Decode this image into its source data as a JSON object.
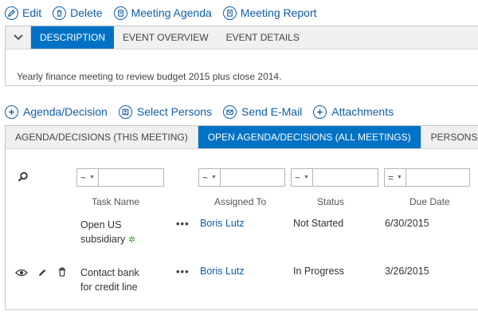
{
  "toolbar": {
    "edit": "Edit",
    "delete": "Delete",
    "meeting_agenda": "Meeting Agenda",
    "meeting_report": "Meeting Report"
  },
  "desc_tabs": [
    "DESCRIPTION",
    "EVENT OVERVIEW",
    "EVENT DETAILS"
  ],
  "description": "Yearly finance meeting to review budget 2015 plus close 2014.",
  "actions": {
    "agenda": "Agenda/Decision",
    "persons": "Select Persons",
    "email": "Send E-Mail",
    "attachments": "Attachments"
  },
  "grid_tabs": [
    "AGENDA/DECISIONS (THIS MEETING)",
    "OPEN AGENDA/DECISIONS (ALL MEETINGS)",
    "PERSONS"
  ],
  "filters": {
    "ops": [
      "~",
      "~",
      "~",
      "="
    ]
  },
  "columns": {
    "task": "Task Name",
    "assigned": "Assigned To",
    "status": "Status",
    "due": "Due Date"
  },
  "rows": [
    {
      "task_line1": "Open US",
      "task_line2": "subsidiary",
      "new_mark": "✲",
      "ellipsis": "•••",
      "assigned": "Boris Lutz",
      "status": "Not Started",
      "due": "6/30/2015"
    },
    {
      "task_line1": "Contact bank",
      "task_line2": "for credit line",
      "ellipsis": "•••",
      "assigned": "Boris Lutz",
      "status": "In Progress",
      "due": "3/26/2015"
    }
  ],
  "colors": {
    "accent": "#0072c6",
    "link": "#0f5ea8",
    "new": "#3c9a3c"
  },
  "icons": [
    "pencil-icon",
    "trash-icon",
    "agenda-document-icon",
    "report-document-icon",
    "plus-icon",
    "people-icon",
    "envelope-icon",
    "chevron-down-icon",
    "search-icon",
    "eye-icon"
  ]
}
